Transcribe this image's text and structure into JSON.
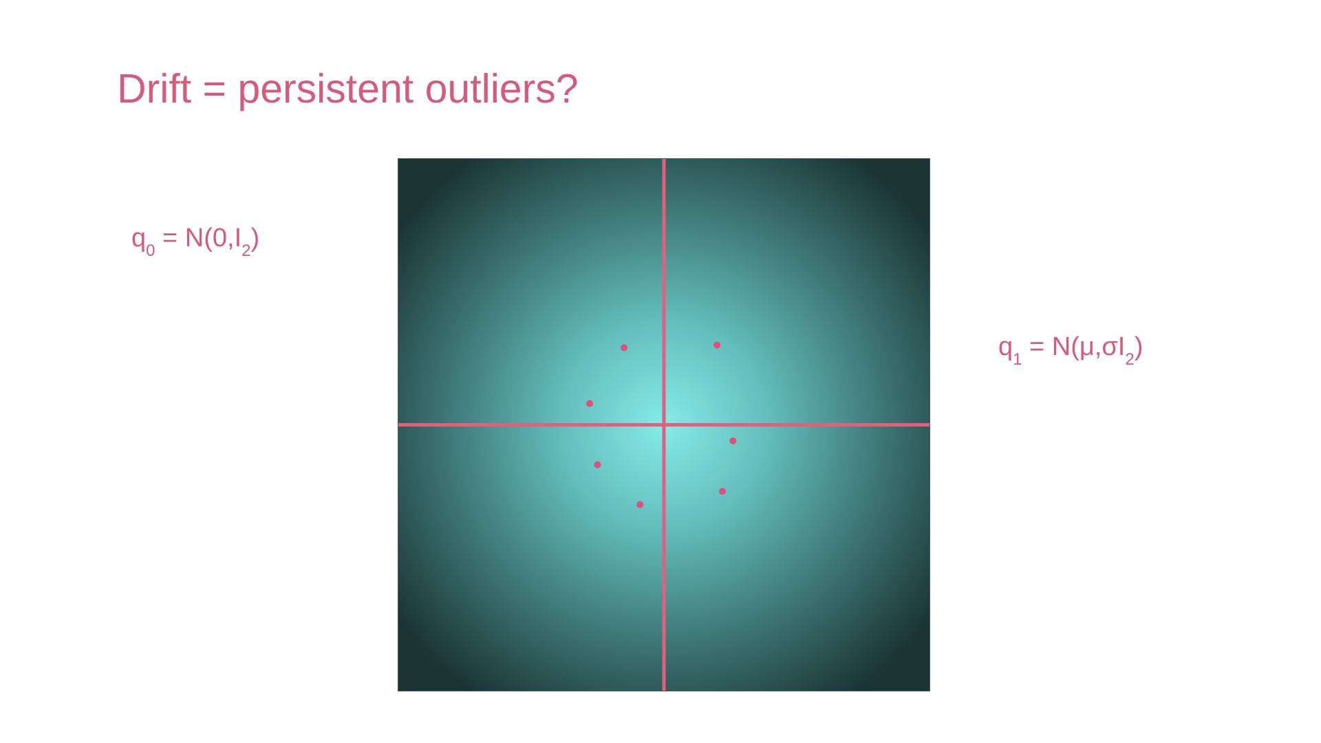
{
  "slide": {
    "title": "Drift = persistent outliers?",
    "q0": {
      "base": "q",
      "sub": "0",
      "mid": " = N(0,I",
      "sub2": "2",
      "end": ")"
    },
    "q1": {
      "base": "q",
      "sub": "1",
      "mid": " = N(μ,σI",
      "sub2": "2",
      "end": ")"
    }
  },
  "colors": {
    "accent": "#d55b7d",
    "axis": "#e0607e",
    "points": "#e0507c"
  },
  "chart_data": {
    "type": "scatter",
    "xlim": [
      -1,
      1
    ],
    "ylim": [
      -1,
      1
    ],
    "grid": false,
    "points": [
      {
        "x": -0.15,
        "y": 0.29
      },
      {
        "x": 0.2,
        "y": 0.3
      },
      {
        "x": -0.28,
        "y": 0.08
      },
      {
        "x": 0.26,
        "y": -0.06
      },
      {
        "x": -0.25,
        "y": -0.15
      },
      {
        "x": 0.22,
        "y": -0.25
      },
      {
        "x": -0.09,
        "y": -0.3
      }
    ]
  }
}
